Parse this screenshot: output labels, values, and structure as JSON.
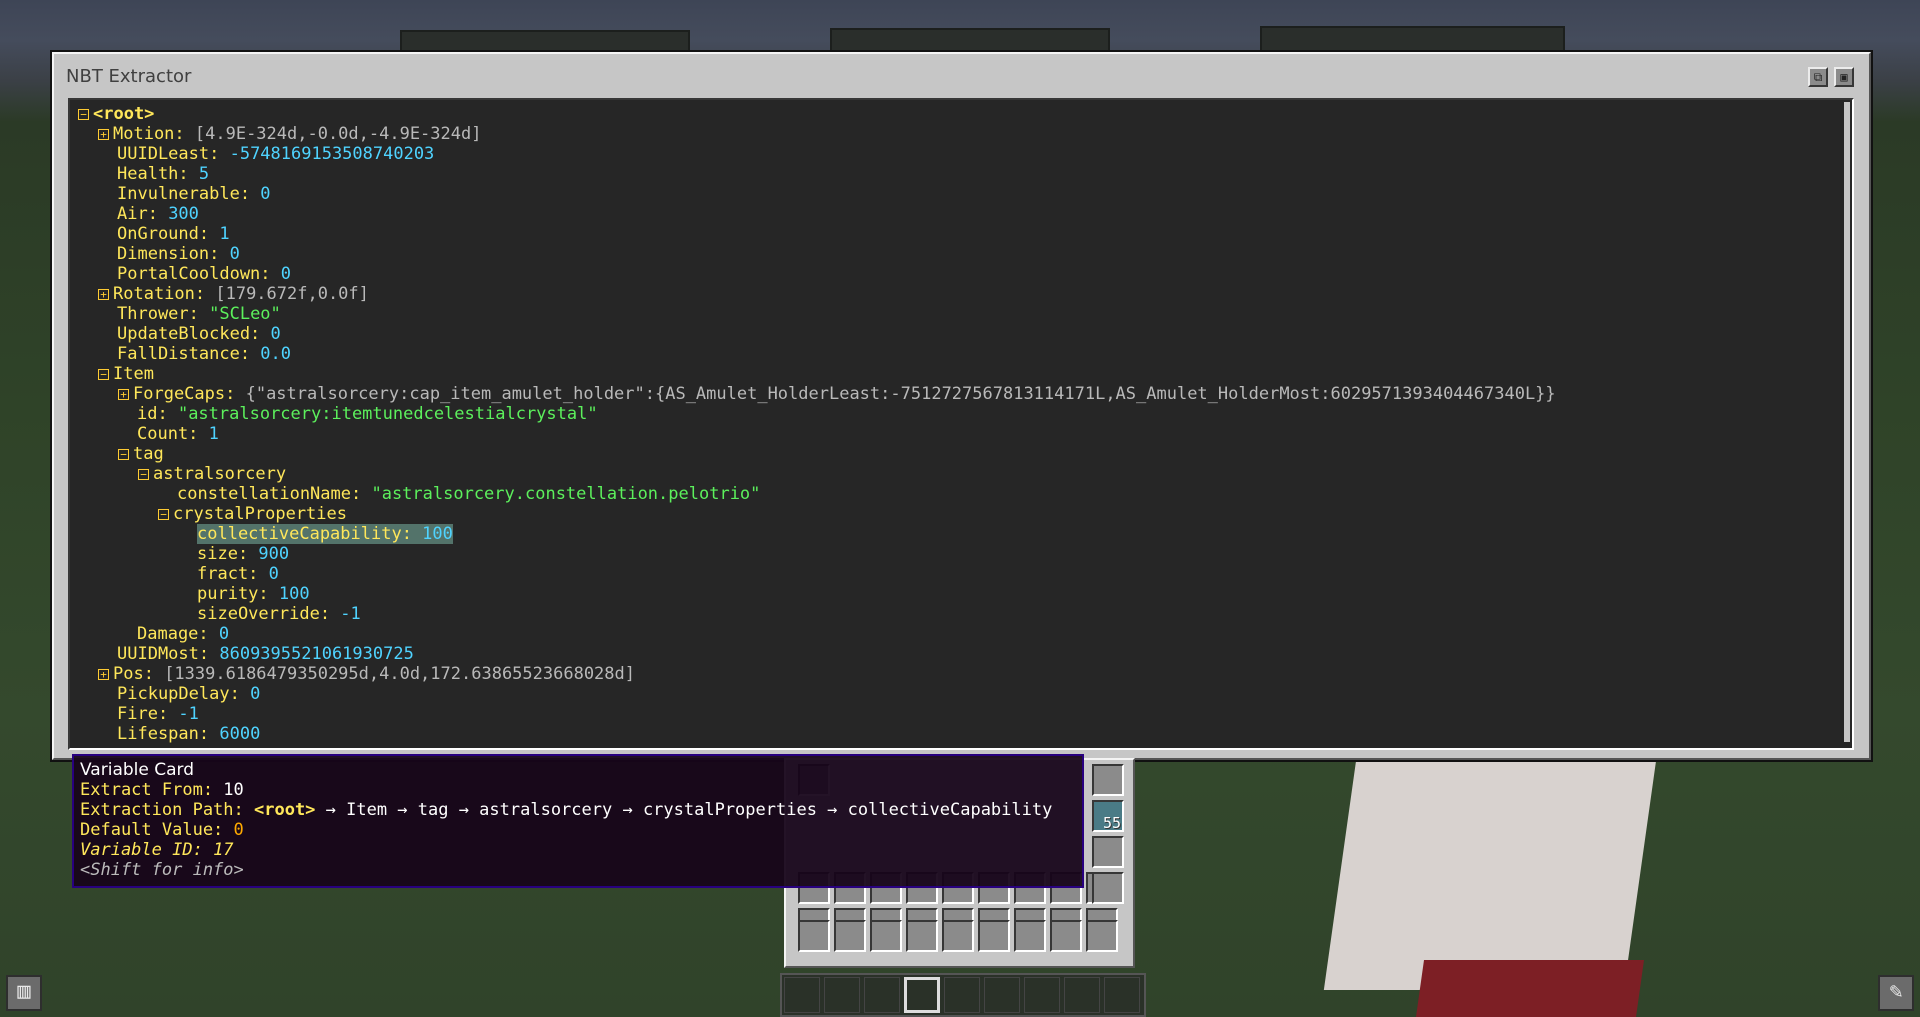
{
  "window": {
    "title": "NBT Extractor",
    "btn_copy_glyph": "⧉",
    "btn_img_glyph": "▣"
  },
  "tree": [
    {
      "d": 0,
      "tog": "−",
      "k": "<root>",
      "v": "",
      "t": "root"
    },
    {
      "d": 1,
      "tog": "+",
      "k": "Motion: ",
      "v": "[4.9E-324d,-0.0d,-4.9E-324d]",
      "t": "list"
    },
    {
      "d": 1,
      "k": "UUIDLeast: ",
      "v": "-5748169153508740203",
      "t": "num"
    },
    {
      "d": 1,
      "k": "Health: ",
      "v": "5",
      "t": "num"
    },
    {
      "d": 1,
      "k": "Invulnerable: ",
      "v": "0",
      "t": "num"
    },
    {
      "d": 1,
      "k": "Air: ",
      "v": "300",
      "t": "num"
    },
    {
      "d": 1,
      "k": "OnGround: ",
      "v": "1",
      "t": "num"
    },
    {
      "d": 1,
      "k": "Dimension: ",
      "v": "0",
      "t": "num"
    },
    {
      "d": 1,
      "k": "PortalCooldown: ",
      "v": "0",
      "t": "num"
    },
    {
      "d": 1,
      "tog": "+",
      "k": "Rotation: ",
      "v": "[179.672f,0.0f]",
      "t": "list"
    },
    {
      "d": 1,
      "k": "Thrower: ",
      "v": "\"SCLeo\"",
      "t": "str"
    },
    {
      "d": 1,
      "k": "UpdateBlocked: ",
      "v": "0",
      "t": "num"
    },
    {
      "d": 1,
      "k": "FallDistance: ",
      "v": "0.0",
      "t": "num"
    },
    {
      "d": 1,
      "tog": "−",
      "k": "Item",
      "v": "",
      "t": "num"
    },
    {
      "d": 2,
      "tog": "+",
      "k": "ForgeCaps: ",
      "v": "{\"astralsorcery:cap_item_amulet_holder\":{AS_Amulet_HolderLeast:-7512727567813114171L,AS_Amulet_HolderMost:6029571393404467340L}}",
      "t": "list"
    },
    {
      "d": 2,
      "k": "id: ",
      "v": "\"astralsorcery:itemtunedcelestialcrystal\"",
      "t": "str"
    },
    {
      "d": 2,
      "k": "Count: ",
      "v": "1",
      "t": "num"
    },
    {
      "d": 2,
      "tog": "−",
      "k": "tag",
      "v": "",
      "t": "num"
    },
    {
      "d": 3,
      "tog": "−",
      "k": "astralsorcery",
      "v": "",
      "t": "num"
    },
    {
      "d": 4,
      "k": "constellationName: ",
      "v": "\"astralsorcery.constellation.pelotrio\"",
      "t": "str"
    },
    {
      "d": 4,
      "tog": "−",
      "k": "crystalProperties",
      "v": "",
      "t": "num"
    },
    {
      "d": 5,
      "k": "collectiveCapability: ",
      "v": "100",
      "t": "num",
      "hl": true
    },
    {
      "d": 5,
      "k": "size: ",
      "v": "900",
      "t": "num"
    },
    {
      "d": 5,
      "k": "fract: ",
      "v": "0",
      "t": "num"
    },
    {
      "d": 5,
      "k": "purity: ",
      "v": "100",
      "t": "num"
    },
    {
      "d": 5,
      "k": "sizeOverride: ",
      "v": "-1",
      "t": "num"
    },
    {
      "d": 2,
      "k": "Damage: ",
      "v": "0",
      "t": "num"
    },
    {
      "d": 1,
      "k": "UUIDMost: ",
      "v": "8609395521061930725",
      "t": "num"
    },
    {
      "d": 1,
      "tog": "+",
      "k": "Pos: ",
      "v": "[1339.6186479350295d,4.0d,172.63865523668028d]",
      "t": "list"
    },
    {
      "d": 1,
      "k": "PickupDelay: ",
      "v": "0",
      "t": "num"
    },
    {
      "d": 1,
      "k": "Fire: ",
      "v": "-1",
      "t": "num"
    },
    {
      "d": 1,
      "k": "Lifespan: ",
      "v": "6000",
      "t": "num"
    }
  ],
  "tooltip": {
    "title": "Variable Card",
    "extract_label": "Extract From: ",
    "extract_value": "10",
    "path_label": "Extraction Path: ",
    "path_root": "<root>",
    "path_rest": " → Item → tag → astralsorcery → crystalProperties → collectiveCapability",
    "default_label": "Default Value: ",
    "default_value": "0",
    "varid_label": "Variable ID: ",
    "varid_value": "17",
    "shift_hint": "<Shift for info>"
  },
  "inventory": {
    "stack_count": "55"
  },
  "colors": {
    "key": "#ffe75a",
    "number": "#4fd3ff",
    "string": "#5cf05c",
    "list": "#b9b9b9",
    "highlight": "#53736a"
  },
  "icons": {
    "bottom_left": "recipe-book-icon",
    "bottom_right": "wrench-icon"
  }
}
